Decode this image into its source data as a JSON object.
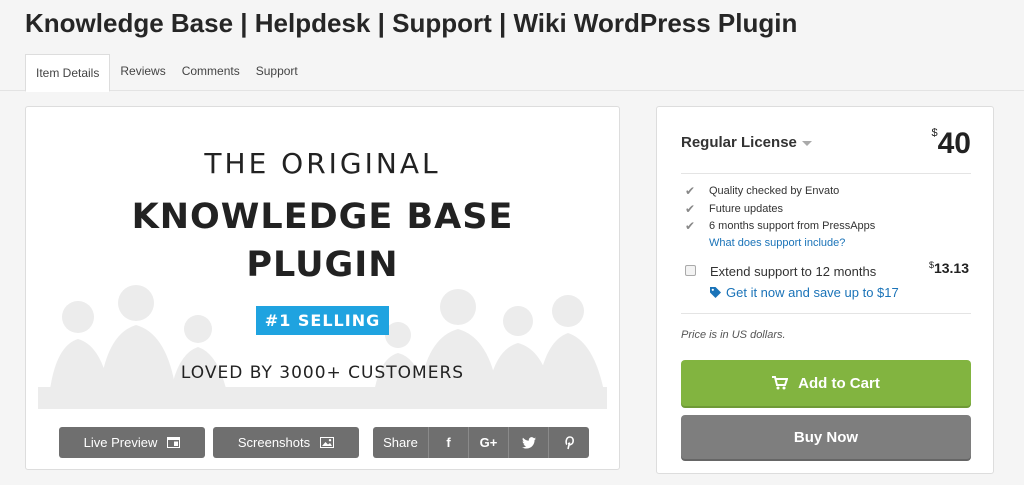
{
  "page": {
    "title": "Knowledge Base | Helpdesk | Support | Wiki WordPress Plugin"
  },
  "tabs": [
    {
      "label": "Item Details",
      "active": true
    },
    {
      "label": "Reviews"
    },
    {
      "label": "Comments"
    },
    {
      "label": "Support"
    }
  ],
  "banner": {
    "line1": "THE ORIGINAL",
    "line2": "KNOWLEDGE BASE",
    "line3": "PLUGIN",
    "badge": "#1 SELLING",
    "line4": "LOVED BY 3000+ CUSTOMERS",
    "badge_color": "#1fa3e0"
  },
  "actions": {
    "live_preview": "Live Preview",
    "screenshots": "Screenshots",
    "share": "Share",
    "share_icons": [
      "f",
      "G+",
      "twitter-icon",
      "pinterest-icon"
    ]
  },
  "purchase": {
    "license": "Regular License",
    "currency": "$",
    "price": "40",
    "features": [
      "Quality checked by Envato",
      "Future updates",
      "6 months support from PressApps"
    ],
    "support_link": "What does support include?",
    "extend_label": "Extend support to 12 months",
    "extend_currency": "$",
    "extend_price": "13.13",
    "extend_checked": false,
    "save_link": "Get it now and save up to $17",
    "note": "Price is in US dollars.",
    "add_to_cart": "Add to Cart",
    "buy_now": "Buy Now",
    "cart_color": "#82b440",
    "buy_color": "#7e7e7e"
  }
}
